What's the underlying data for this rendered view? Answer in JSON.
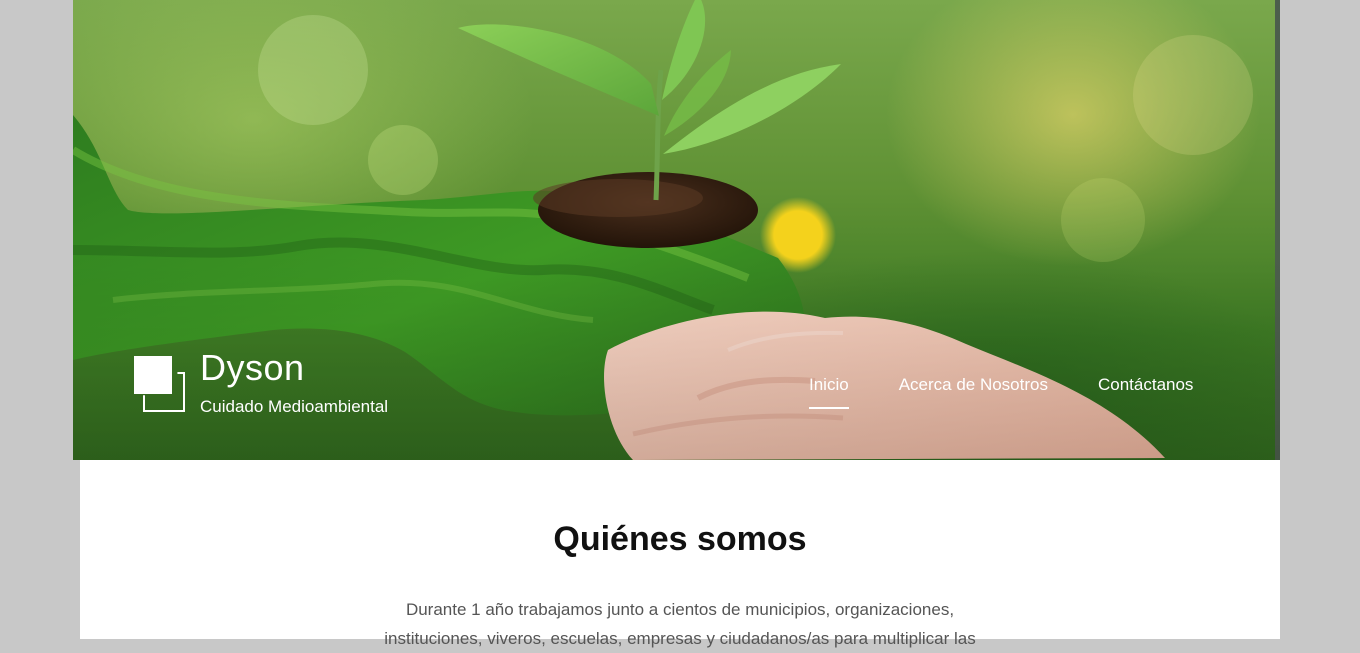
{
  "site": {
    "name": "Dyson",
    "tagline": "Cuidado Medioambiental"
  },
  "nav": {
    "items": [
      {
        "label": "Inicio",
        "active": true
      },
      {
        "label": "Acerca de Nosotros",
        "active": false
      },
      {
        "label": "Contáctanos",
        "active": false
      }
    ]
  },
  "hero": {
    "image": "hand-with-plant-image"
  },
  "section": {
    "title": "Quiénes somos",
    "description": "Durante 1 año trabajamos junto a cientos de municipios, organizaciones, instituciones, viveros, escuelas, empresas y ciudadanos/as para multiplicar las"
  }
}
